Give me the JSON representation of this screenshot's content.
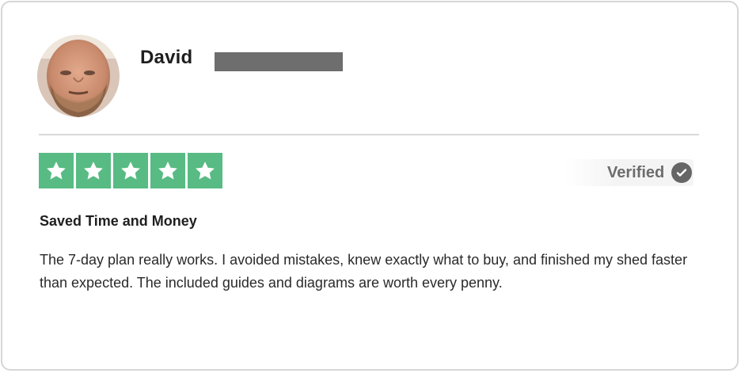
{
  "review": {
    "author_name": "David",
    "rating": 5,
    "verified_label": "Verified",
    "title": "Saved Time and Money",
    "body": "The 7-day plan really works. I avoided mistakes, knew exactly what to buy, and finished my shed faster than expected. The included guides and diagrams are worth every penny."
  },
  "icons": {
    "star": "star-icon",
    "verified": "check-circle-icon"
  },
  "colors": {
    "star_background": "#57bb83",
    "verified_text": "#6c6c6c",
    "redaction": "#6e6e6e"
  }
}
